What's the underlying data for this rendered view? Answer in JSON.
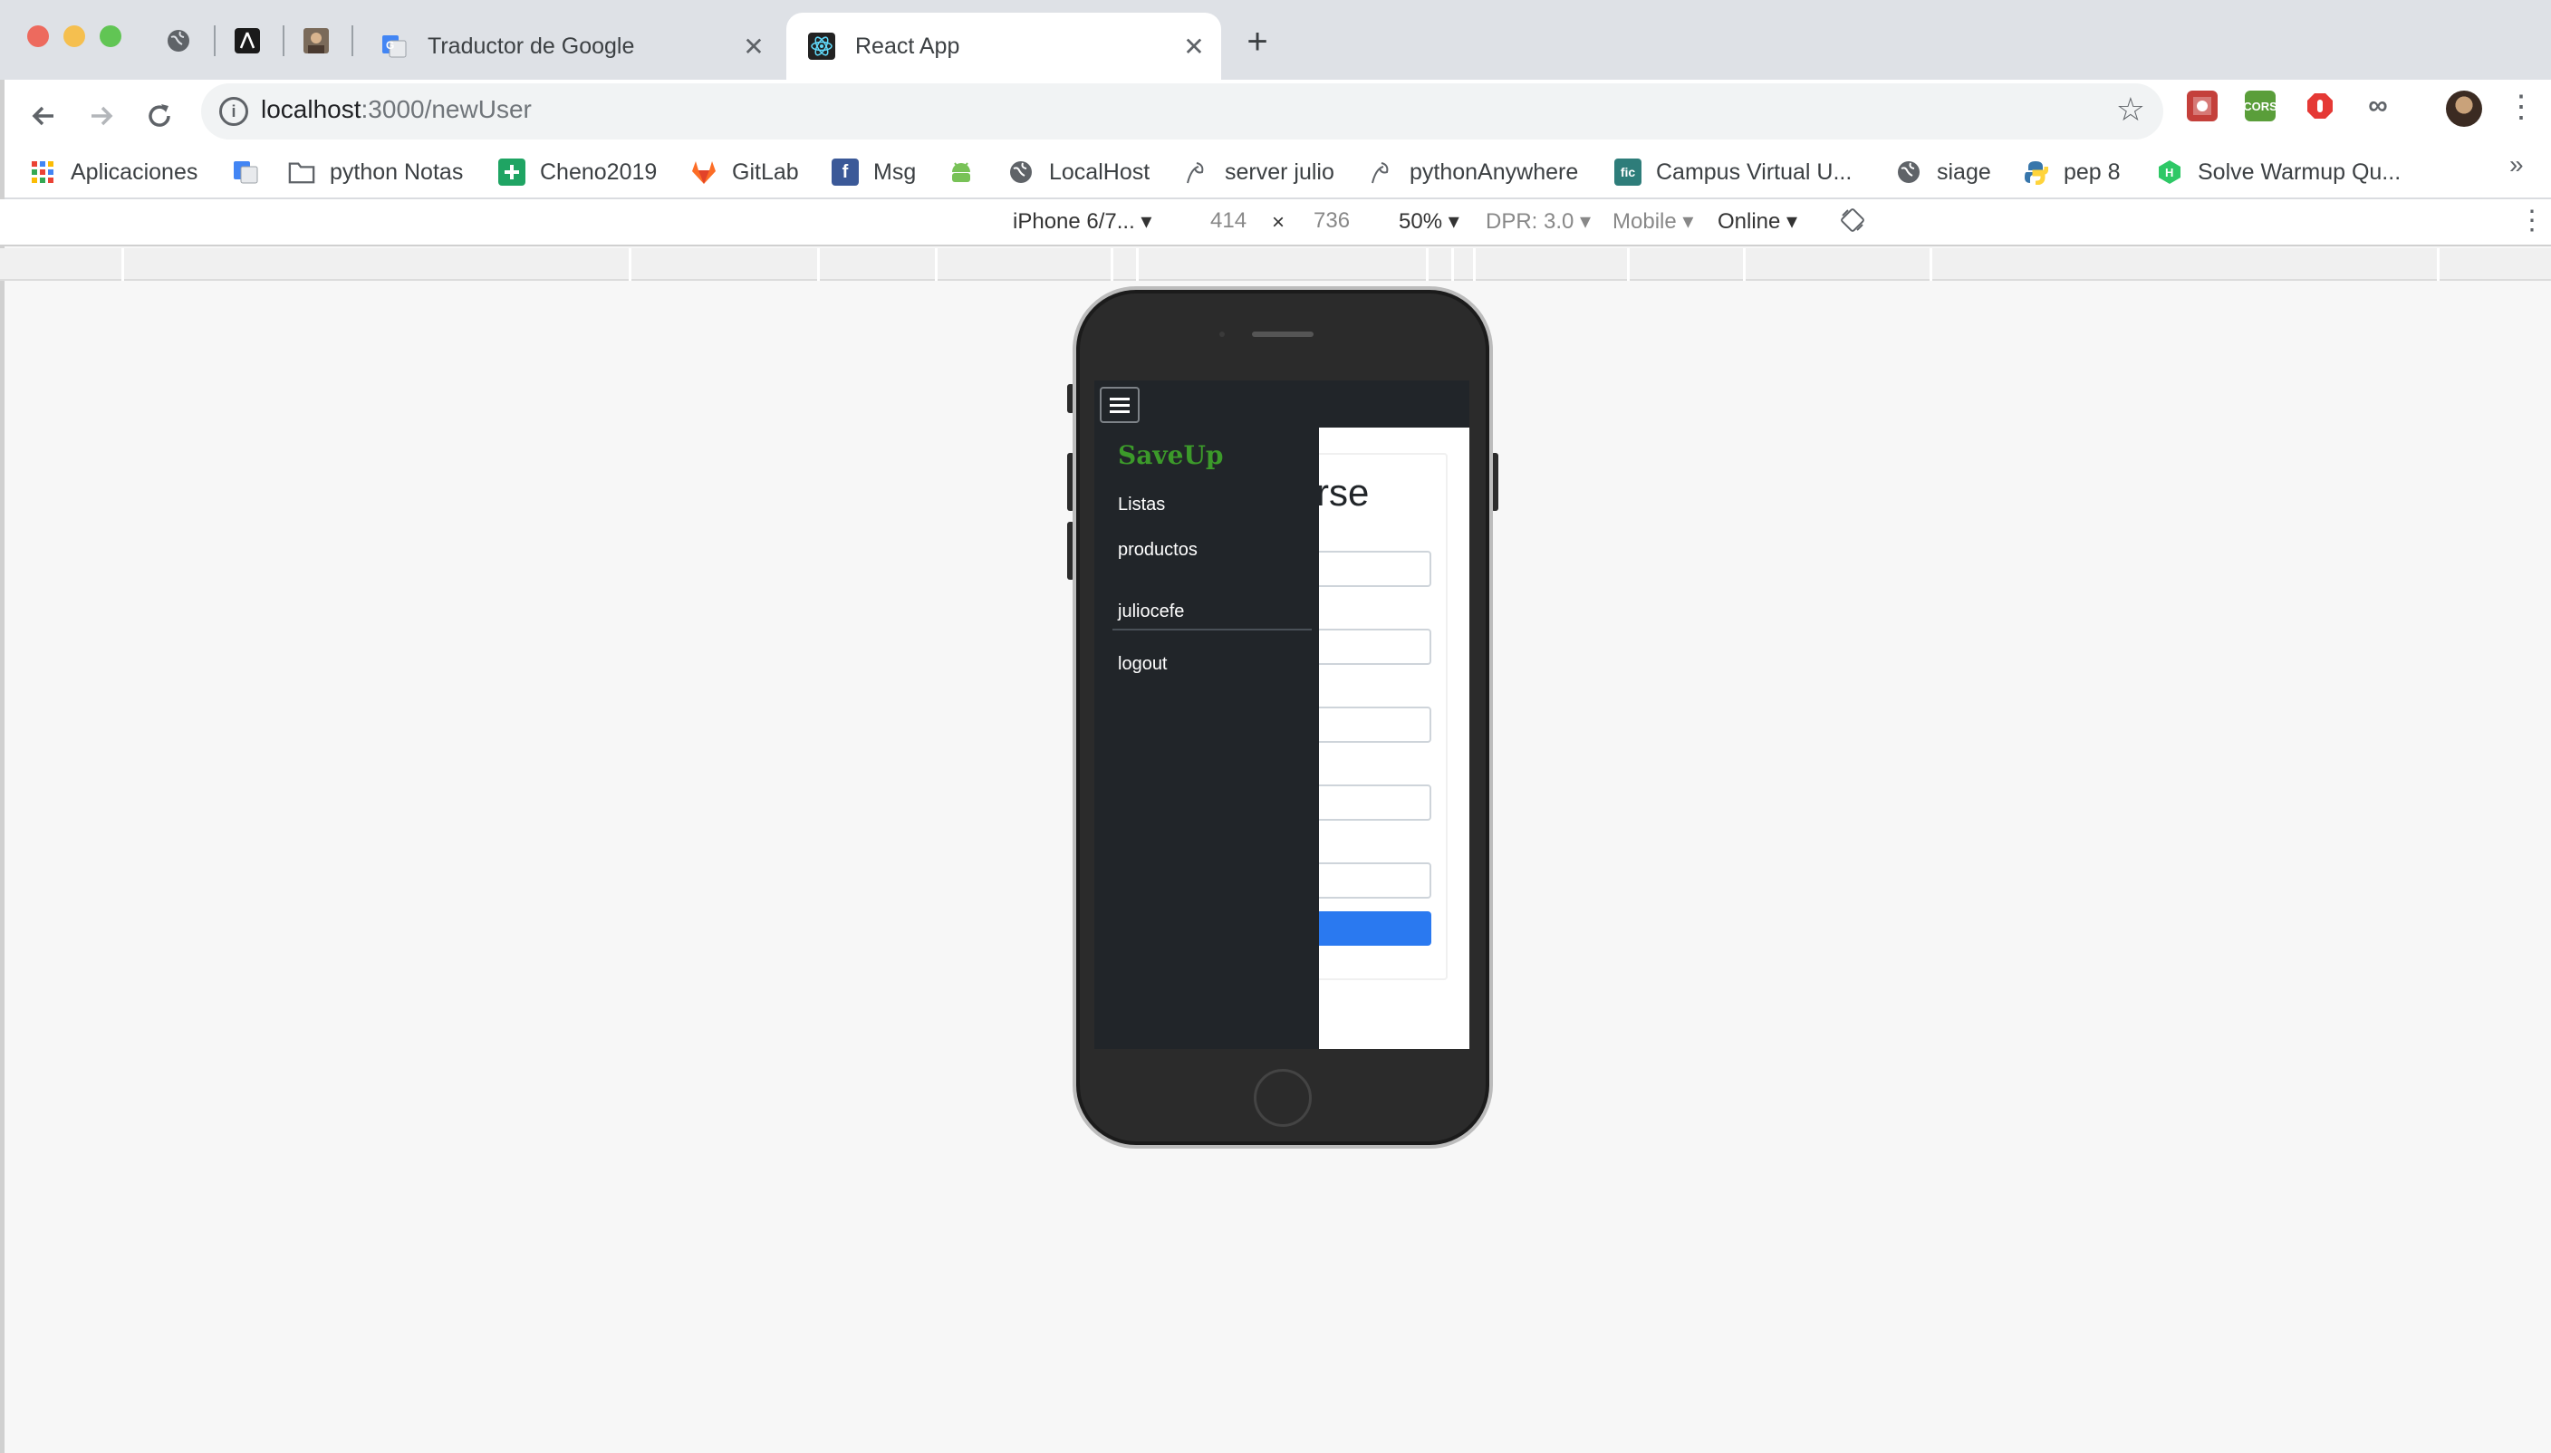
{
  "browser": {
    "tabs": [
      {
        "title": "Traductor de Google",
        "active": false
      },
      {
        "title": "React App",
        "active": true
      }
    ],
    "address": {
      "host": "localhost",
      "path": ":3000/newUser"
    },
    "bookmarks": [
      {
        "label": "Aplicaciones",
        "icon": "apps-grid-icon"
      },
      {
        "label": "",
        "icon": "google-translate-icon"
      },
      {
        "label": "python Notas",
        "icon": "folder-icon"
      },
      {
        "label": "Cheno2019",
        "icon": "sheets-icon"
      },
      {
        "label": "GitLab",
        "icon": "gitlab-icon"
      },
      {
        "label": "Msg",
        "icon": "facebook-icon"
      },
      {
        "label": "",
        "icon": "android-icon"
      },
      {
        "label": "LocalHost",
        "icon": "globe-icon"
      },
      {
        "label": "server julio",
        "icon": "server-icon"
      },
      {
        "label": "pythonAnywhere",
        "icon": "server-icon"
      },
      {
        "label": "Campus Virtual U...",
        "icon": "campus-icon"
      },
      {
        "label": "siage",
        "icon": "globe-icon"
      },
      {
        "label": "pep 8",
        "icon": "python-icon"
      },
      {
        "label": "Solve Warmup Qu...",
        "icon": "hackerrank-icon"
      }
    ],
    "more_bookmarks": "»"
  },
  "devtools": {
    "device": "iPhone 6/7...",
    "width": "414",
    "times": "×",
    "height": "736",
    "zoom": "50%",
    "dpr": "DPR: 3.0",
    "mode": "Mobile",
    "network": "Online"
  },
  "app": {
    "brand": "SaveUp",
    "links": [
      "Listas",
      "productos"
    ],
    "user": "juliocefe",
    "logout": "logout",
    "form_title_visible": "rse"
  },
  "colors": {
    "brand": "#3c9a2a",
    "navbar": "#212529",
    "submit": "#2a79f0"
  }
}
